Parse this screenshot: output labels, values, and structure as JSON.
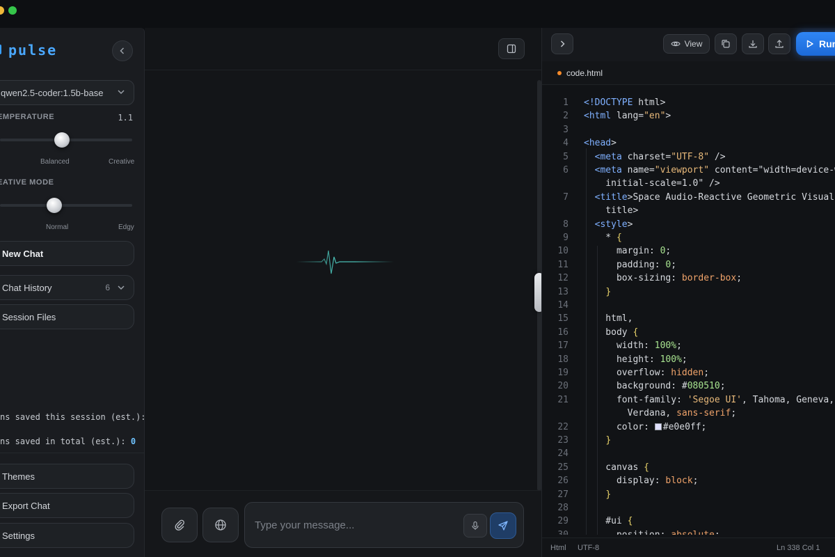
{
  "colors": {
    "accent": "#2f86f5",
    "brand": "#4aa8ff",
    "tab_dot": "#f58a2a",
    "swatch_bg": "#080510",
    "swatch_color": "#e0e0ff"
  },
  "sidebar": {
    "brand": "pulse",
    "model": "qwen2.5-coder:1.5b-base",
    "temperature": {
      "label": "EMPERATURE",
      "value": "1.1",
      "level": 0.47,
      "captions": [
        "Balanced",
        "Creative"
      ]
    },
    "creative_mode": {
      "label": "EATIVE MODE",
      "level": 0.41,
      "captions": [
        "Normal",
        "Edgy"
      ]
    },
    "buttons": {
      "new_chat": "New Chat",
      "chat_history": "Chat History",
      "chat_history_count": "6",
      "session_files": "Session Files"
    },
    "stats": {
      "session": "ns saved this session (est.):",
      "total": "ns saved in total (est.):",
      "total_value": "0"
    },
    "footer": {
      "themes": "Themes",
      "export": "Export Chat",
      "settings": "Settings"
    }
  },
  "composer": {
    "placeholder": "Type your message..."
  },
  "code_panel": {
    "view_label": "View",
    "run_label": "Run",
    "file_tab": "code.html",
    "status": {
      "lang": "Html",
      "encoding": "UTF-8",
      "position": "Ln 338 Col 1"
    }
  },
  "icons": [
    "chevron-left-icon",
    "chevron-down-icon",
    "sidebar-toggle-icon",
    "pulse-wave-icon",
    "paperclip-icon",
    "globe-icon",
    "microphone-icon",
    "send-icon",
    "chevron-right-icon",
    "eye-icon",
    "copy-icon",
    "download-icon",
    "upload-icon",
    "play-icon"
  ],
  "code_lines": [
    {
      "n": "1",
      "t": "<!DOCTYPE html>"
    },
    {
      "n": "2",
      "t": "<html lang=\"en\">"
    },
    {
      "n": "3",
      "t": ""
    },
    {
      "n": "4",
      "t": "<head>"
    },
    {
      "n": "5",
      "t": "  <meta charset=\"UTF-8\" />"
    },
    {
      "n": "6",
      "t": "  <meta name=\"viewport\" content=\"width=device-w"
    },
    {
      "n": "",
      "t": "    initial-scale=1.0\" />"
    },
    {
      "n": "7",
      "t": "  <title>Space Audio-Reactive Geometric Visuali"
    },
    {
      "n": "",
      "t": "    title>"
    },
    {
      "n": "8",
      "t": "  <style>"
    },
    {
      "n": "9",
      "t": "    * {"
    },
    {
      "n": "10",
      "t": "      margin: 0;"
    },
    {
      "n": "11",
      "t": "      padding: 0;"
    },
    {
      "n": "12",
      "t": "      box-sizing: border-box;"
    },
    {
      "n": "13",
      "t": "    }"
    },
    {
      "n": "14",
      "t": ""
    },
    {
      "n": "15",
      "t": "    html,"
    },
    {
      "n": "16",
      "t": "    body {"
    },
    {
      "n": "17",
      "t": "      width: 100%;"
    },
    {
      "n": "18",
      "t": "      height: 100%;"
    },
    {
      "n": "19",
      "t": "      overflow: hidden;"
    },
    {
      "n": "20",
      "t": "      background: #080510;"
    },
    {
      "n": "21",
      "t": "      font-family: 'Segoe UI', Tahoma, Geneva,"
    },
    {
      "n": "",
      "t": "        Verdana, sans-serif;"
    },
    {
      "n": "22",
      "t": "      color: #e0e0ff;"
    },
    {
      "n": "23",
      "t": "    }"
    },
    {
      "n": "24",
      "t": ""
    },
    {
      "n": "25",
      "t": "    canvas {"
    },
    {
      "n": "26",
      "t": "      display: block;"
    },
    {
      "n": "27",
      "t": "    }"
    },
    {
      "n": "28",
      "t": ""
    },
    {
      "n": "29",
      "t": "    #ui {"
    },
    {
      "n": "30",
      "t": "      position: absolute;"
    }
  ]
}
